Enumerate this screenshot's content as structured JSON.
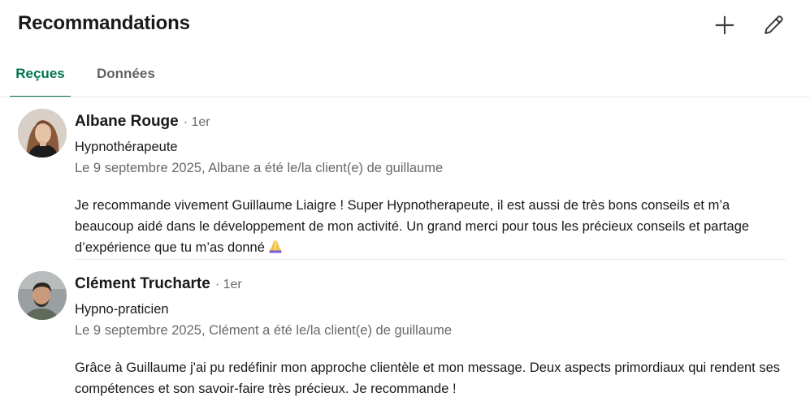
{
  "header": {
    "title": "Recommandations",
    "add_icon": "plus-icon",
    "edit_icon": "pencil-icon"
  },
  "tabs": [
    {
      "label": "Reçues",
      "active": true
    },
    {
      "label": "Données",
      "active": false
    }
  ],
  "colors": {
    "accent": "#01754f",
    "text": "#191919",
    "muted": "#666666",
    "divider": "#e8e8e8"
  },
  "recommendations": [
    {
      "name": "Albane Rouge",
      "degree": "· 1er",
      "headline": "Hypnothérapeute",
      "meta": "Le 9 septembre 2025, Albane a été le/la client(e) de guillaume",
      "text": "Je recommande vivement Guillaume Liaigre ! Super Hypnotherapeute, il est aussi de très bons conseils et m’a beaucoup aidé dans le développement de mon activité. Un grand merci pour tous les précieux conseils et partage d’expérience que tu m’as donné",
      "emoji": "folded-hands-icon"
    },
    {
      "name": "Clément Trucharte",
      "degree": "· 1er",
      "headline": "Hypno-praticien",
      "meta": "Le 9 septembre 2025, Clément a été le/la client(e) de guillaume",
      "text": "Grâce à Guillaume j'ai pu redéfinir mon approche clientèle et mon message. Deux aspects primordiaux qui rendent ses compétences et son savoir-faire très précieux. Je recommande !"
    }
  ]
}
